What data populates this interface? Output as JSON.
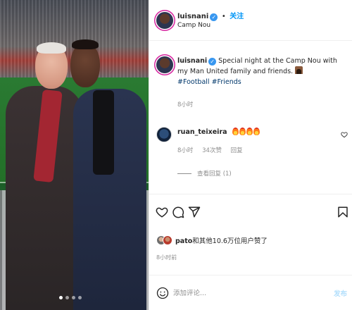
{
  "photo": {
    "alt_subject": "",
    "carousel_dots": 4,
    "active_dot": 1
  },
  "header": {
    "username": "luisnani",
    "separator": "•",
    "follow_label": "关注",
    "location": "Camp Nou"
  },
  "caption": {
    "username": "luisnani",
    "text": "Special night at the Camp Nou with my Man United family and friends.",
    "hashtags": "#Football #Friends",
    "time": "8小时"
  },
  "comments": [
    {
      "username": "ruan_teixeira",
      "emoji": "fire-icon x4",
      "time": "8小时",
      "likes": "34次赞",
      "reply_label": "回复",
      "view_replies": "查看回复 (1)"
    }
  ],
  "actions": {
    "like_icon": "heart-icon",
    "comment_icon": "comment-icon",
    "share_icon": "send-icon",
    "save_icon": "bookmark-icon"
  },
  "likes": {
    "name": "pato",
    "text": "和其他10.6万位用户赞了"
  },
  "date": "8小时前",
  "comment_box": {
    "placeholder": "添加评论...",
    "post_label": "发布"
  },
  "colors": {
    "accent": "#0095f6",
    "verified": "#3897f0",
    "muted_text": "#8e8e8e",
    "hashtag": "#00376b"
  }
}
